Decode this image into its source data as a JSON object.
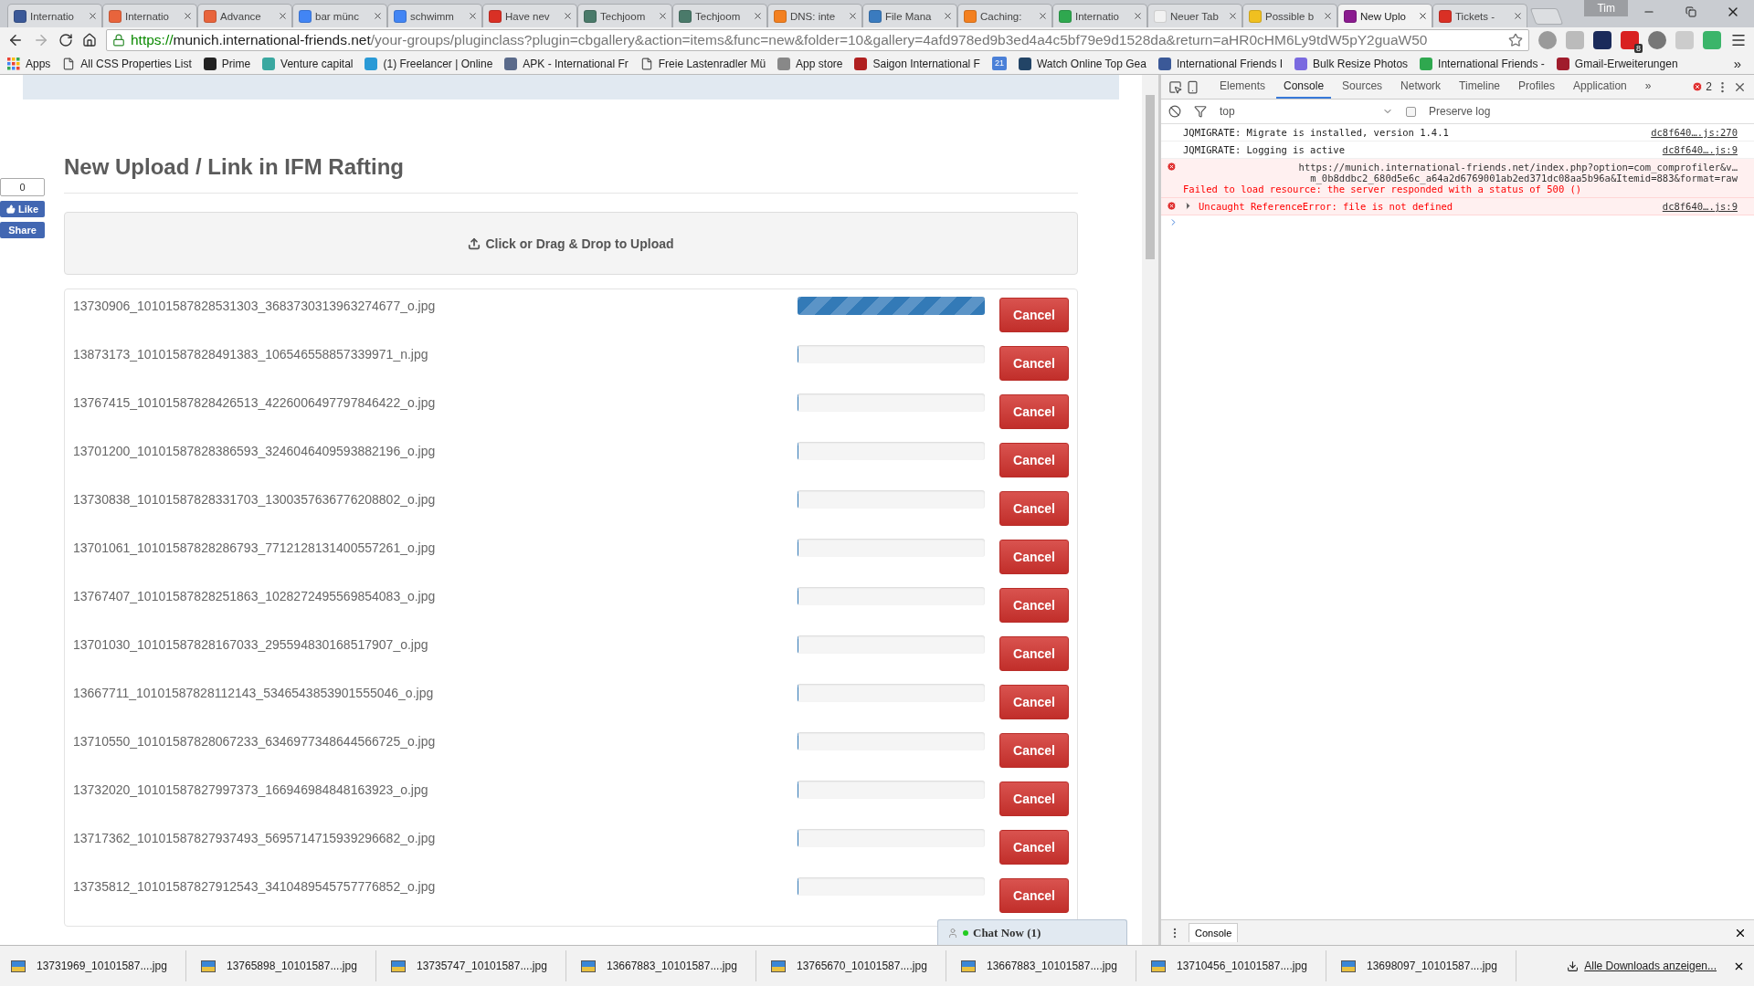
{
  "browser": {
    "tabs": [
      {
        "title": "Internatio",
        "selected": false,
        "color": "#3b5998"
      },
      {
        "title": "Internatio",
        "selected": false,
        "color": "#e8643c"
      },
      {
        "title": "Advance",
        "selected": false,
        "color": "#e8643c"
      },
      {
        "title": "bar münc",
        "selected": false,
        "color": "#4285f4"
      },
      {
        "title": "schwimm",
        "selected": false,
        "color": "#4285f4"
      },
      {
        "title": "Have nev",
        "selected": false,
        "color": "#d93025"
      },
      {
        "title": "Techjoom",
        "selected": false,
        "color": "#4a7a6a"
      },
      {
        "title": "Techjoom",
        "selected": false,
        "color": "#4a7a6a"
      },
      {
        "title": "DNS: inte",
        "selected": false,
        "color": "#f38020"
      },
      {
        "title": "File Mana",
        "selected": false,
        "color": "#3a7bbf"
      },
      {
        "title": "Caching:",
        "selected": false,
        "color": "#f38020"
      },
      {
        "title": "Internatio",
        "selected": false,
        "color": "#2fa84f"
      },
      {
        "title": "Neuer Tab",
        "selected": false,
        "color": "#f2f2f2"
      },
      {
        "title": "Possible b",
        "selected": false,
        "color": "#f0c020"
      },
      {
        "title": "New Uplo",
        "selected": true,
        "color": "#8a1b8f"
      },
      {
        "title": "Tickets -",
        "selected": false,
        "color": "#d93025"
      }
    ],
    "profile": "Tim",
    "url": {
      "scheme": "https://",
      "host": "munich.international-friends.net",
      "path": "/your-groups/pluginclass?plugin=cbgallery&action=items&func=new&folder=10&gallery=4afd978ed9b3ed4a4c5bf79e9d1528da&return=aHR0cHM6Ly9tdW5pY2guaW50"
    },
    "extension_badge": "8",
    "bookmarks": [
      {
        "kind": "apps",
        "label": "Apps"
      },
      {
        "kind": "page",
        "label": "All CSS Properties List"
      },
      {
        "kind": "site",
        "label": "Prime",
        "color": "#222222"
      },
      {
        "kind": "site",
        "label": "Venture capital",
        "color": "#3aa8a0"
      },
      {
        "kind": "site",
        "label": "(1) Freelancer | Online",
        "color": "#2a9ad6"
      },
      {
        "kind": "site",
        "label": "APK - International Fr",
        "color": "#5a6a8a"
      },
      {
        "kind": "page",
        "label": "Freie Lastenradler Mü"
      },
      {
        "kind": "site",
        "label": "App store",
        "color": "#888888"
      },
      {
        "kind": "site",
        "label": "Saigon International F",
        "color": "#b02020"
      },
      {
        "kind": "calendar",
        "label": "21"
      },
      {
        "kind": "site",
        "label": "Watch Online Top Gea",
        "color": "#224466"
      },
      {
        "kind": "site",
        "label": "International Friends I",
        "color": "#3b5998"
      },
      {
        "kind": "site",
        "label": "Bulk Resize Photos",
        "color": "#7a6ae0"
      },
      {
        "kind": "site",
        "label": "International Friends -",
        "color": "#2fa84f"
      },
      {
        "kind": "site",
        "label": "Gmail-Erweiterungen",
        "color": "#a01c2c"
      }
    ],
    "bookmarks_more": "»"
  },
  "page": {
    "like_count": "0",
    "like_label": "Like",
    "share_label": "Share",
    "heading": "New Upload / Link in IFM Rafting",
    "dropzone": "Click or Drag & Drop to Upload",
    "files": [
      {
        "name": "13730906_10101587828531303_3683730313963274677_o.jpg",
        "level": 1,
        "button": "Cancel"
      },
      {
        "name": "13873173_10101587828491383_106546558857339971_n.jpg",
        "level": 0,
        "button": "Cancel"
      },
      {
        "name": "13767415_10101587828426513_4226006497797846422_o.jpg",
        "level": 0,
        "button": "Cancel"
      },
      {
        "name": "13701200_10101587828386593_3246046409593882196_o.jpg",
        "level": 0,
        "button": "Cancel"
      },
      {
        "name": "13730838_10101587828331703_1300357636776208802_o.jpg",
        "level": 0,
        "button": "Cancel"
      },
      {
        "name": "13701061_10101587828286793_7712128131400557261_o.jpg",
        "level": 0,
        "button": "Cancel"
      },
      {
        "name": "13767407_10101587828251863_1028272495569854083_o.jpg",
        "level": 0,
        "button": "Cancel"
      },
      {
        "name": "13701030_10101587828167033_295594830168517907_o.jpg",
        "level": 0,
        "button": "Cancel"
      },
      {
        "name": "13667711_10101587828112143_5346543853901555046_o.jpg",
        "level": 0,
        "button": "Cancel"
      },
      {
        "name": "13710550_10101587828067233_6346977348644566725_o.jpg",
        "level": 0,
        "button": "Cancel"
      },
      {
        "name": "13732020_10101587827997373_166946984848163923_o.jpg",
        "level": 0,
        "button": "Cancel"
      },
      {
        "name": "13717362_10101587827937493_5695714715939296682_o.jpg",
        "level": 0,
        "button": "Cancel"
      },
      {
        "name": "13735812_10101587827912543_3410489545757776852_o.jpg",
        "level": 0,
        "button": "Cancel"
      }
    ],
    "chat": "Chat Now (1)"
  },
  "devtools": {
    "tabs": [
      {
        "label": "Elements",
        "selected": false
      },
      {
        "label": "Console",
        "selected": true
      },
      {
        "label": "Sources",
        "selected": false
      },
      {
        "label": "Network",
        "selected": false
      },
      {
        "label": "Timeline",
        "selected": false
      },
      {
        "label": "Profiles",
        "selected": false
      },
      {
        "label": "Application",
        "selected": false
      }
    ],
    "more": "»",
    "error_count": "2",
    "context": "top",
    "preserve_log": {
      "label": "Preserve log",
      "checked": false
    },
    "messages": [
      {
        "kind": "log",
        "text": "JQMIGRATE: Migrate is installed, version 1.4.1",
        "source": "dc8f640….js:270"
      },
      {
        "kind": "log",
        "text": "JQMIGRATE: Logging is active",
        "source": "dc8f640….js:9"
      },
      {
        "kind": "network_error",
        "url_lines": [
          "https://munich.international-friends.net/index.php?option=com_comprofiler&v…",
          "m_0b8ddbc2_680d5e6c_a64a2d6769001ab2ed371dc08aa5b96a&Itemid=883&format=raw"
        ],
        "text": "Failed to load resource: the server responded with a status of 500 ()"
      },
      {
        "kind": "error",
        "expandable": true,
        "text": "Uncaught ReferenceError: file is not defined",
        "source": "dc8f640….js:9"
      }
    ],
    "drawer_tab": "Console"
  },
  "downloads": {
    "items": [
      "13731969_10101587....jpg",
      "13765898_10101587....jpg",
      "13735747_10101587....jpg",
      "13667883_10101587....jpg",
      "13765670_10101587....jpg",
      "13667883_10101587....jpg",
      "13710456_10101587....jpg",
      "13698097_10101587....jpg"
    ],
    "show_all": "Alle Downloads anzeigen..."
  }
}
